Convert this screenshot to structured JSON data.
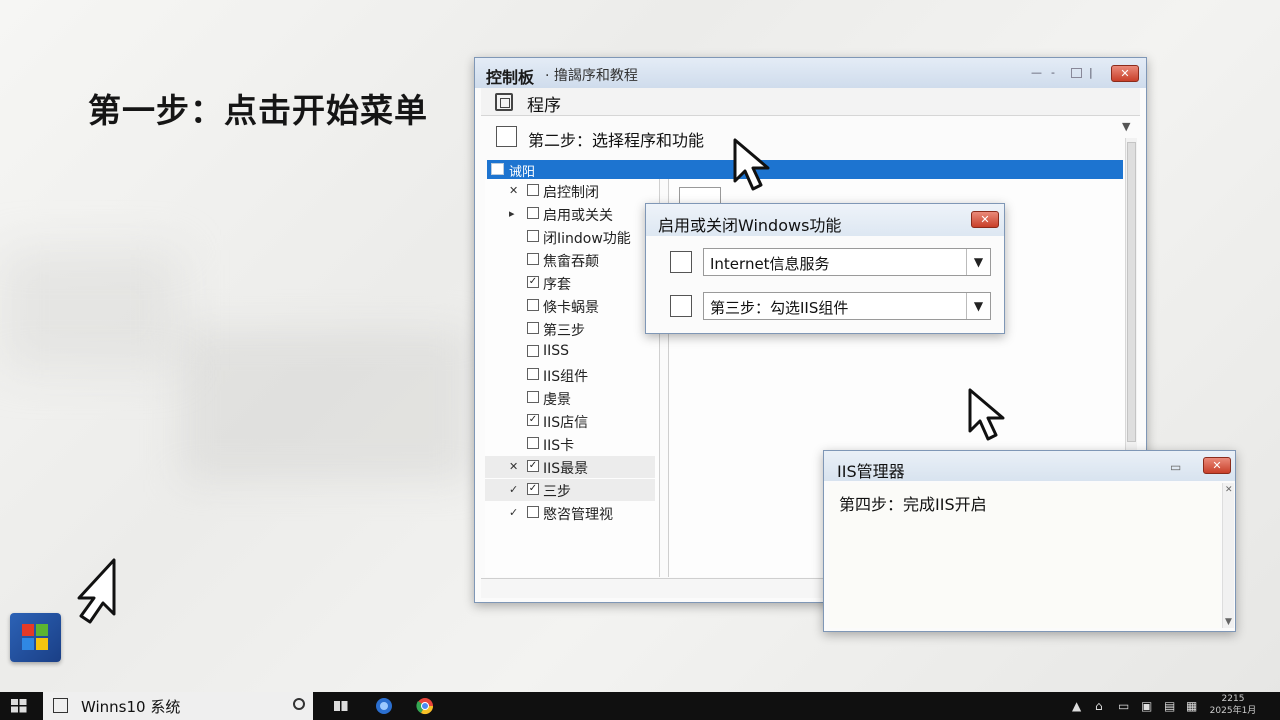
{
  "heading": {
    "step1": "第一步：点击开始菜单"
  },
  "control_panel": {
    "title": "控制板",
    "subtitle": "· 撸謁序和教程",
    "program_label": "程序",
    "step2": "第二步：选择程序和功能",
    "selected_item": "诫阳",
    "tree_items": [
      {
        "mark": "✕",
        "checked": false,
        "label": "启控制闭"
      },
      {
        "mark": "▸",
        "checked": false,
        "label": "启用或关关"
      },
      {
        "mark": "",
        "checked": false,
        "label": "闭Iindow功能"
      },
      {
        "mark": "",
        "checked": false,
        "label": "焦畲吞颠"
      },
      {
        "mark": "",
        "checked": true,
        "label": "序套"
      },
      {
        "mark": "",
        "checked": false,
        "label": "倏卡蜗景"
      },
      {
        "mark": "",
        "checked": false,
        "label": "第三步"
      },
      {
        "mark": "",
        "checked": false,
        "label": "IISS"
      },
      {
        "mark": "",
        "checked": false,
        "label": "IIS组件"
      },
      {
        "mark": "",
        "checked": false,
        "label": "虔景"
      },
      {
        "mark": "",
        "checked": true,
        "label": "IIS店信"
      },
      {
        "mark": "",
        "checked": false,
        "label": "IIS卡"
      },
      {
        "mark": "✕",
        "checked": true,
        "label": "IIS最景"
      },
      {
        "mark": "✓",
        "checked": true,
        "label": "三步"
      },
      {
        "mark": "✓",
        "checked": false,
        "label": "愍咨管理视"
      }
    ]
  },
  "features_dialog": {
    "title": "启用或关闭Windows功能",
    "rows": [
      {
        "label": "Internet信息服务"
      },
      {
        "label": "第三步：勾选IIS组件"
      }
    ]
  },
  "iis_manager": {
    "title": "IIS管理器",
    "step4": "第四步：完成IIS开启"
  },
  "taskbar": {
    "app_label": "Winns10 系统",
    "time": "2215",
    "date": "2025年1月"
  },
  "colors": {
    "selection": "#1d74d0",
    "close": "#c8402a",
    "taskbar": "#101010",
    "start": "#2c62b6"
  }
}
